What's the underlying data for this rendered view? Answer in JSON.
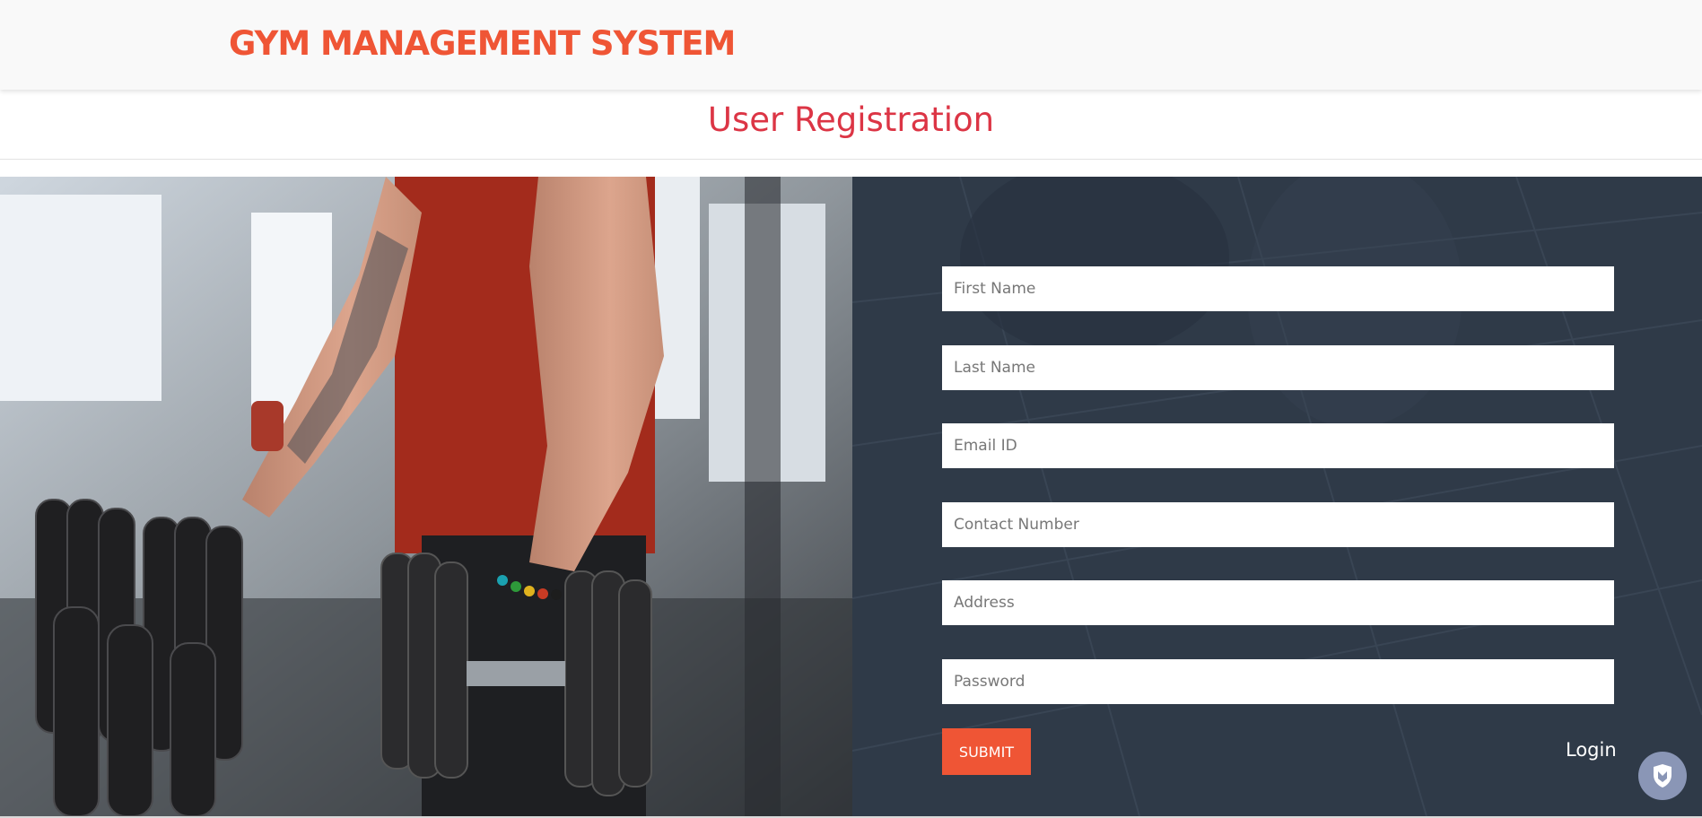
{
  "header": {
    "brand": "GYM MANAGEMENT SYSTEM"
  },
  "page": {
    "title": "User Registration"
  },
  "hero": {
    "image": "gym-dumbbell-photo"
  },
  "form": {
    "fields": [
      {
        "placeholder": "First Name",
        "value": ""
      },
      {
        "placeholder": "Last Name",
        "value": ""
      },
      {
        "placeholder": "Email ID",
        "value": ""
      },
      {
        "placeholder": "Contact Number",
        "value": ""
      },
      {
        "placeholder": "Address",
        "value": ""
      },
      {
        "placeholder": "Password",
        "value": ""
      }
    ],
    "submit_label": "SUBMIT",
    "login_label": "Login"
  },
  "widget": {
    "icon": "shield-icon"
  },
  "colors": {
    "brand": "#ef5535",
    "title": "#dc3545",
    "panel": "#2f3a48",
    "widget": "#8a96b6"
  }
}
